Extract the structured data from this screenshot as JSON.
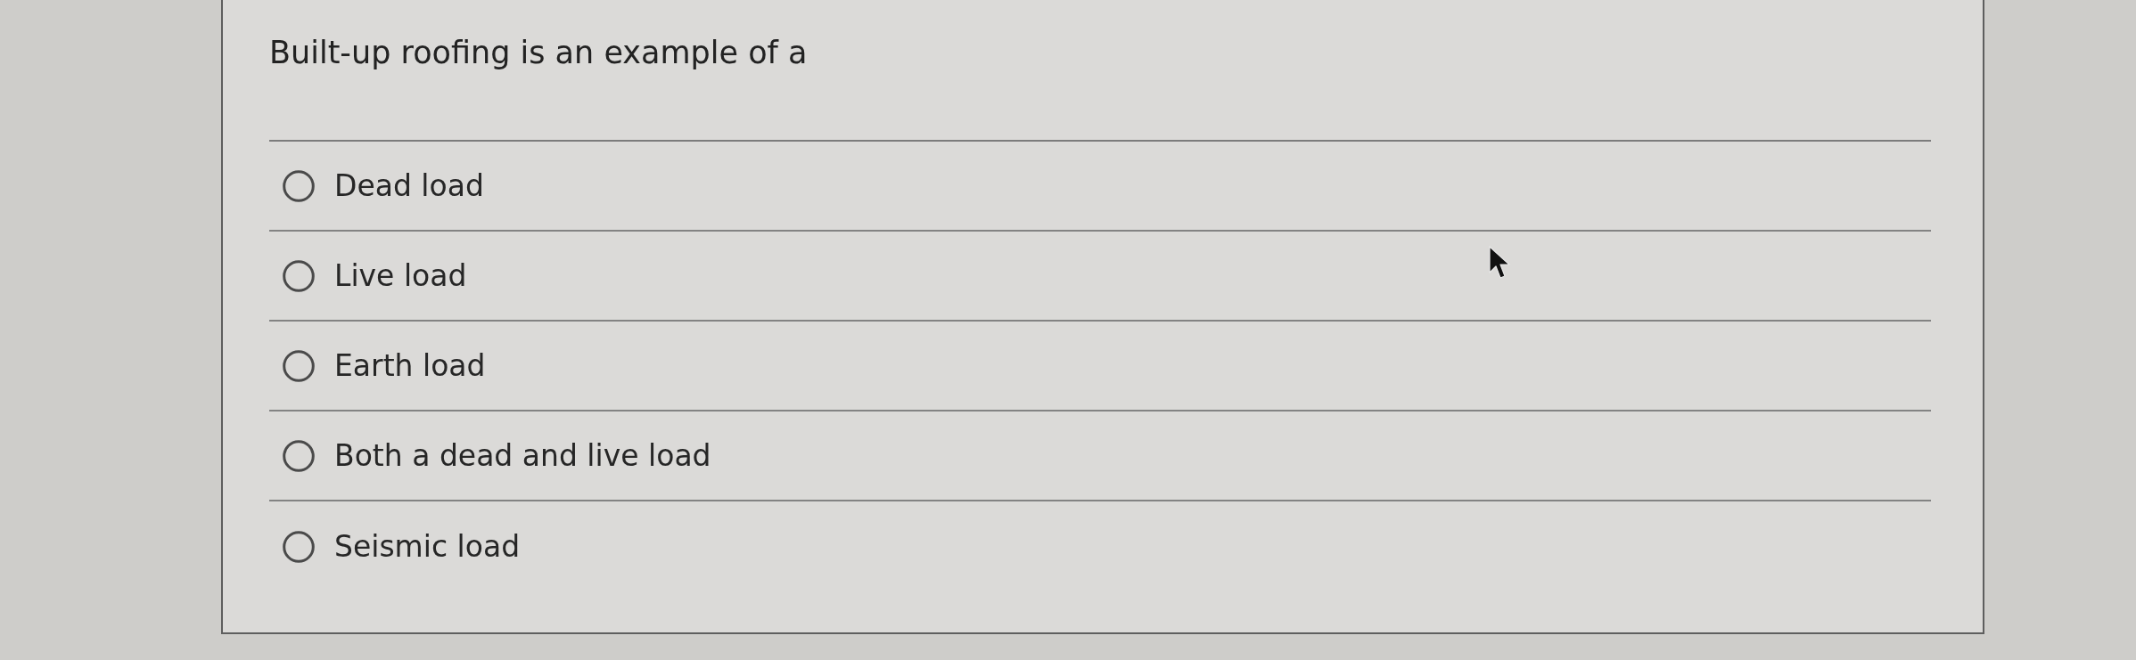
{
  "question": {
    "text": "Built-up roofing is an example of a"
  },
  "options": [
    {
      "label": "Dead load",
      "selected": false
    },
    {
      "label": "Live load",
      "selected": false
    },
    {
      "label": "Earth load",
      "selected": false
    },
    {
      "label": "Both a dead and live load",
      "selected": false
    },
    {
      "label": "Seismic load",
      "selected": false
    }
  ]
}
